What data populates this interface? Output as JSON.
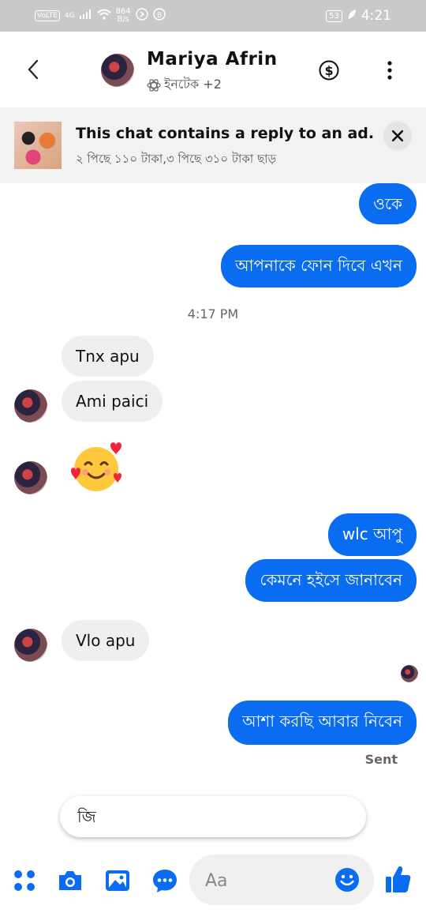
{
  "status_bar": {
    "volte": "VoLTE",
    "network": "4G",
    "speed_value": "864",
    "speed_unit": "B/s",
    "battery": "53",
    "time": "4:21"
  },
  "header": {
    "contact_name": "Mariya Afrin",
    "subtitle": "ইনটেক +2"
  },
  "ad_banner": {
    "title": "This chat contains a reply to an ad.",
    "description": "২ পিছে ১১০ টাকা,৩ পিছে ৩১০ টাকা ছাড়"
  },
  "messages": [
    {
      "dir": "out",
      "text": "ওকে"
    },
    {
      "dir": "out",
      "text": "আপনাকে ফোন দিবে এখন"
    },
    {
      "type": "timestamp",
      "text": "4:17 PM"
    },
    {
      "dir": "in",
      "text": "Tnx apu"
    },
    {
      "dir": "in",
      "text": "Ami paici"
    },
    {
      "dir": "in",
      "type": "emoji",
      "text": "🥰"
    },
    {
      "dir": "out",
      "text": "wlc আপু"
    },
    {
      "dir": "out",
      "text": "কেমনে হইসে জানাবেন"
    },
    {
      "dir": "in",
      "text": "Vlo apu"
    },
    {
      "dir": "out",
      "text": "আশা করছি আবার নিবেন"
    }
  ],
  "sent_status": "Sent",
  "quick_reply": "জি",
  "composer": {
    "placeholder": "Aa"
  },
  "icons": {
    "back": "chevron-left-icon",
    "payment": "dollar-circle-icon",
    "more": "more-vertical-icon",
    "close": "close-icon",
    "menu": "grid-dots-icon",
    "camera": "camera-icon",
    "gallery": "image-icon",
    "chat": "chat-bubble-icon",
    "emoji": "smile-icon",
    "like": "thumbs-up-icon"
  },
  "colors": {
    "accent": "#0a6cf0",
    "incoming_bubble": "#efefef",
    "status_bar": "#c9c9c9"
  }
}
